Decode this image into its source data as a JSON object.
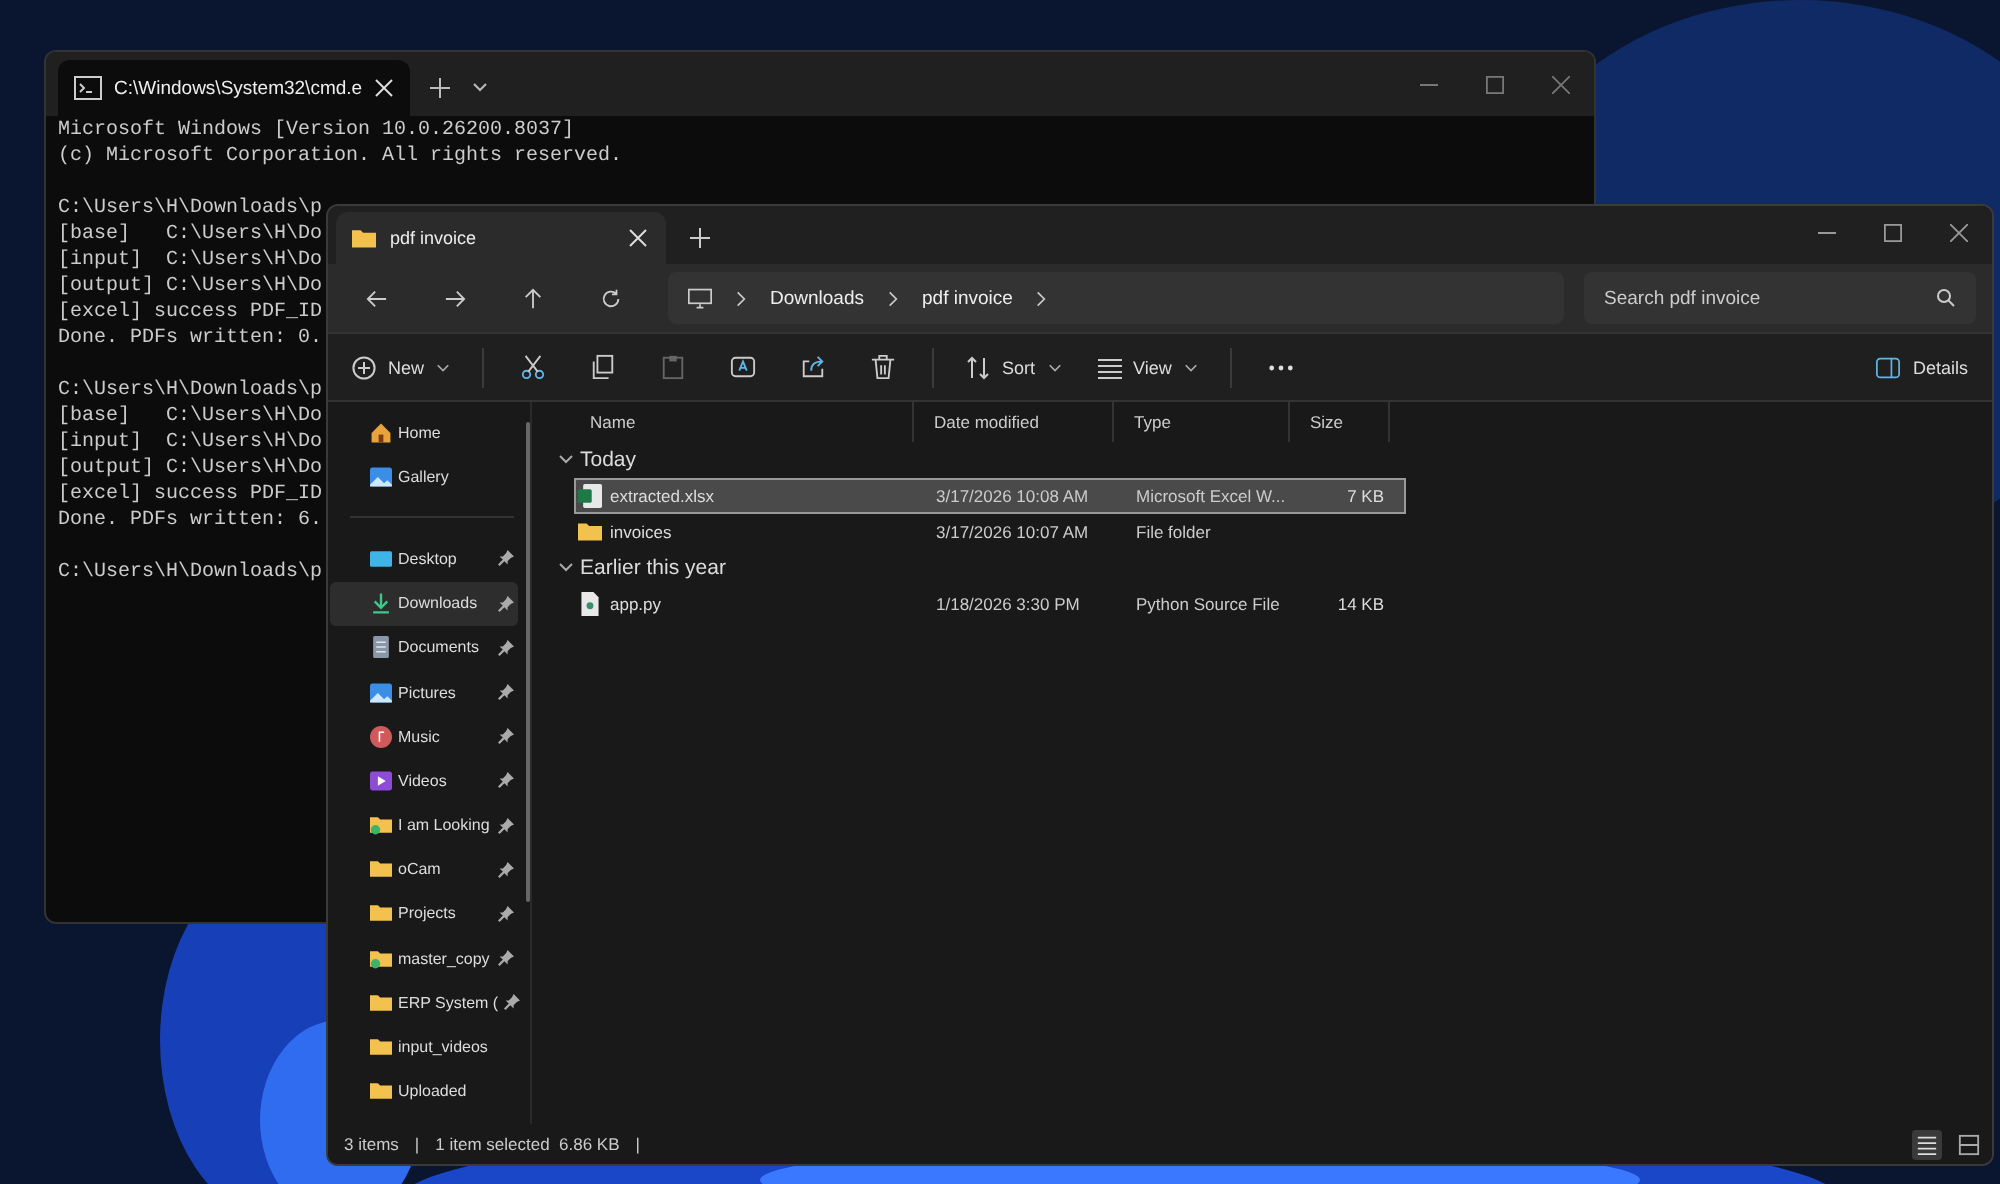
{
  "terminal": {
    "tab_title": "C:\\Windows\\System32\\cmd.e",
    "blocks": [
      [
        "Microsoft Windows [Version 10.0.26200.8037]",
        "(c) Microsoft Corporation. All rights reserved."
      ],
      [
        "C:\\Users\\H\\Downloads\\p",
        "[base]   C:\\Users\\H\\Do",
        "[input]  C:\\Users\\H\\Do",
        "[output] C:\\Users\\H\\Do",
        "[excel] success PDF_ID",
        "Done. PDFs written: 0."
      ],
      [
        "C:\\Users\\H\\Downloads\\p",
        "[base]   C:\\Users\\H\\Do",
        "[input]  C:\\Users\\H\\Do",
        "[output] C:\\Users\\H\\Do",
        "[excel] success PDF_ID",
        "Done. PDFs written: 6."
      ],
      [
        "C:\\Users\\H\\Downloads\\p"
      ]
    ]
  },
  "explorer": {
    "tab_title": "pdf invoice",
    "breadcrumb": [
      "Downloads",
      "pdf invoice"
    ],
    "search": {
      "placeholder": "Search pdf invoice"
    },
    "toolbar": {
      "new": "New",
      "sort": "Sort",
      "view": "View",
      "details": "Details"
    },
    "sidebar": [
      {
        "label": "Home",
        "kind": "home",
        "pinned": false,
        "selected": false
      },
      {
        "label": "Gallery",
        "kind": "gallery",
        "pinned": false,
        "selected": false
      },
      {
        "label": "Desktop",
        "kind": "desktop",
        "pinned": true,
        "selected": false
      },
      {
        "label": "Downloads",
        "kind": "downloads",
        "pinned": true,
        "selected": true
      },
      {
        "label": "Documents",
        "kind": "documents",
        "pinned": true,
        "selected": false
      },
      {
        "label": "Pictures",
        "kind": "gallery",
        "pinned": true,
        "selected": false
      },
      {
        "label": "Music",
        "kind": "music",
        "pinned": true,
        "selected": false
      },
      {
        "label": "Videos",
        "kind": "videos",
        "pinned": true,
        "selected": false
      },
      {
        "label": "I am Looking",
        "kind": "synced-folder",
        "pinned": true,
        "selected": false
      },
      {
        "label": "oCam",
        "kind": "folder",
        "pinned": true,
        "selected": false
      },
      {
        "label": "Projects",
        "kind": "folder",
        "pinned": true,
        "selected": false
      },
      {
        "label": "master_copy",
        "kind": "synced-folder",
        "pinned": true,
        "selected": false
      },
      {
        "label": "ERP System (",
        "kind": "folder",
        "pinned": true,
        "selected": false
      },
      {
        "label": "input_videos",
        "kind": "folder",
        "pinned": false,
        "selected": false
      },
      {
        "label": "Uploaded",
        "kind": "folder",
        "pinned": false,
        "selected": false
      }
    ],
    "columns": [
      "Name",
      "Date modified",
      "Type",
      "Size"
    ],
    "groups": [
      {
        "label": "Today",
        "rows": [
          {
            "name": "extracted.xlsx",
            "kind": "excel",
            "date": "3/17/2026 10:08 AM",
            "type": "Microsoft Excel W...",
            "size": "7 KB",
            "selected": true
          },
          {
            "name": "invoices",
            "kind": "folder",
            "date": "3/17/2026 10:07 AM",
            "type": "File folder",
            "selected": false
          }
        ]
      },
      {
        "label": "Earlier this year",
        "rows": [
          {
            "name": "app.py",
            "kind": "python",
            "date": "1/18/2026 3:30 PM",
            "type": "Python Source File",
            "size": "14 KB",
            "selected": false
          }
        ]
      }
    ],
    "status_bar": [
      "3 items",
      "|",
      "1 item selected  6.86 KB",
      "|"
    ]
  }
}
